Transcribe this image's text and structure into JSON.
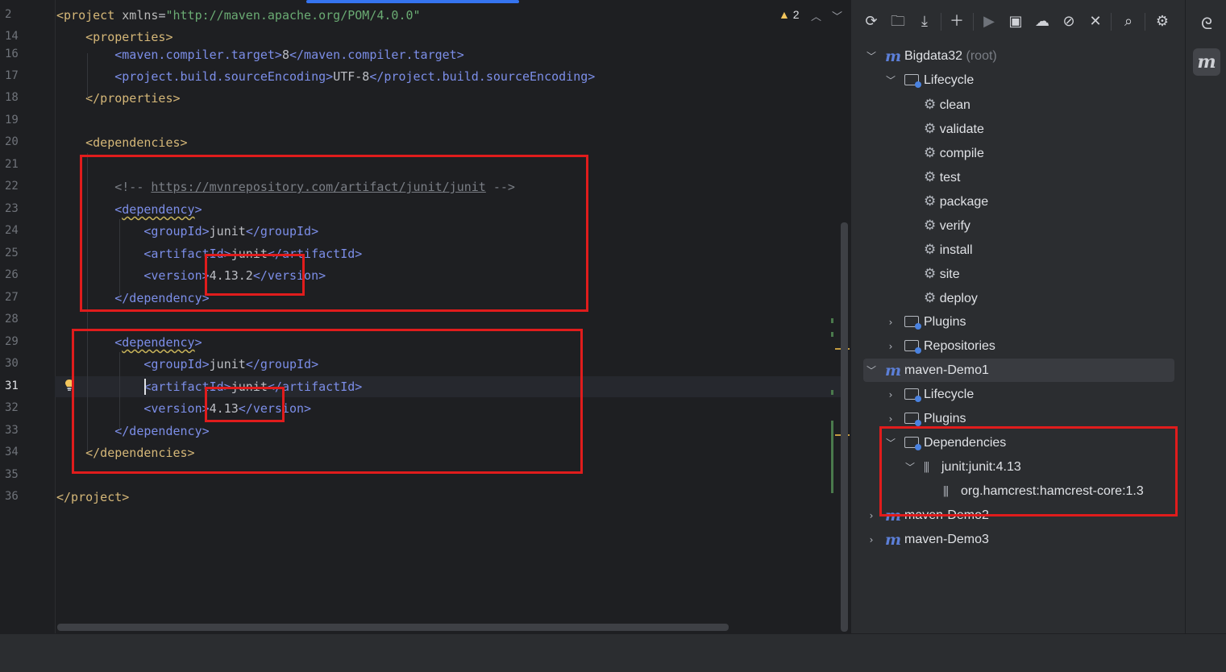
{
  "editor": {
    "warnings_count": "2",
    "lines": [
      {
        "n": "2",
        "html": "<span class=\"tag\">&lt;project</span> <span class=\"attr\">xmlns</span>=<span class=\"str\">\"http://maven.apache.org/POM/4.0.0\"</span>"
      },
      {
        "n": "14",
        "html": "    <span class=\"tag\">&lt;properties&gt;</span>"
      },
      {
        "n": "16",
        "html": "        <span class=\"tagb\">&lt;maven.compiler.target&gt;</span><span class=\"txt\">8</span><span class=\"tagb\">&lt;/maven.compiler.target&gt;</span>"
      },
      {
        "n": "17",
        "html": "        <span class=\"tagb\">&lt;project.build.sourceEncoding&gt;</span><span class=\"txt\">UTF-8</span><span class=\"tagb\">&lt;/project.build.sourceEncoding&gt;</span>"
      },
      {
        "n": "18",
        "html": "    <span class=\"tag\">&lt;/properties&gt;</span>"
      },
      {
        "n": "19",
        "html": ""
      },
      {
        "n": "20",
        "html": "    <span class=\"tag\">&lt;dependencies&gt;</span>"
      },
      {
        "n": "21",
        "html": ""
      },
      {
        "n": "22",
        "html": "        <span class=\"cmt\">&lt;!-- </span><span class=\"link\">https://mvnrepository.com/artifact/junit/junit</span><span class=\"cmt\"> --&gt;</span>"
      },
      {
        "n": "23",
        "html": "        <span class=\"tagb\">&lt;<span class=\"squig\">dependency</span>&gt;</span>"
      },
      {
        "n": "24",
        "html": "            <span class=\"tagb\">&lt;groupId&gt;</span><span class=\"txt\">junit</span><span class=\"tagb\">&lt;/groupId&gt;</span>"
      },
      {
        "n": "25",
        "html": "            <span class=\"tagb\">&lt;artifactId&gt;</span><span class=\"txt\">junit</span><span class=\"tagb\">&lt;/artifactId&gt;</span>"
      },
      {
        "n": "26",
        "html": "            <span class=\"tagb\">&lt;version&gt;</span><span class=\"txt\">4.13.2</span><span class=\"tagb\">&lt;/version&gt;</span>"
      },
      {
        "n": "27",
        "html": "        <span class=\"tagb\">&lt;/dependency&gt;</span>"
      },
      {
        "n": "28",
        "html": ""
      },
      {
        "n": "29",
        "html": "        <span class=\"tagb\">&lt;<span class=\"squig\">dependency</span>&gt;</span>"
      },
      {
        "n": "30",
        "html": "            <span class=\"tagb\">&lt;groupId&gt;</span><span class=\"txt\">junit</span><span class=\"tagb\">&lt;/groupId&gt;</span>"
      },
      {
        "n": "31",
        "html": "            <span class=\"tagb\">&lt;artifactId&gt;</span><span class=\"txt\">junit</span><span class=\"tagb\">&lt;/artifactId&gt;</span>"
      },
      {
        "n": "32",
        "html": "            <span class=\"tagb\">&lt;version&gt;</span><span class=\"txt\">4.13</span><span class=\"tagb\">&lt;/version&gt;</span>"
      },
      {
        "n": "33",
        "html": "        <span class=\"tagb\">&lt;/dependency&gt;</span>"
      },
      {
        "n": "34",
        "html": "    <span class=\"tag\">&lt;/dependencies&gt;</span>"
      },
      {
        "n": "35",
        "html": ""
      },
      {
        "n": "36",
        "html": "<span class=\"tag\">&lt;/project&gt;</span>"
      }
    ]
  },
  "maven": {
    "toolbar": [
      "reload-icon",
      "reimport-folder-icon",
      "download-icon",
      "add-icon",
      "run-icon",
      "run-config-icon",
      "offline-icon",
      "skip-tests-icon",
      "collapse-icon",
      "analyze-icon",
      "settings-icon"
    ],
    "tree": {
      "root_name": "Bigdata32",
      "root_hint": "(root)",
      "lifecycle": "Lifecycle",
      "goals": [
        "clean",
        "validate",
        "compile",
        "test",
        "package",
        "verify",
        "install",
        "site",
        "deploy"
      ],
      "plugins": "Plugins",
      "repositories": "Repositories",
      "demo1": "maven-Demo1",
      "demo1_lifecycle": "Lifecycle",
      "demo1_plugins": "Plugins",
      "dependencies": "Dependencies",
      "dep_junit": "junit:junit:4.13",
      "dep_hamcrest": "org.hamcrest:hamcrest-core:1.3",
      "demo2": "maven-Demo2",
      "demo3": "maven-Demo3"
    }
  },
  "right_strip": {
    "icons": [
      "ai-assistant-icon",
      "maven-icon"
    ],
    "maven_glyph": "m"
  }
}
